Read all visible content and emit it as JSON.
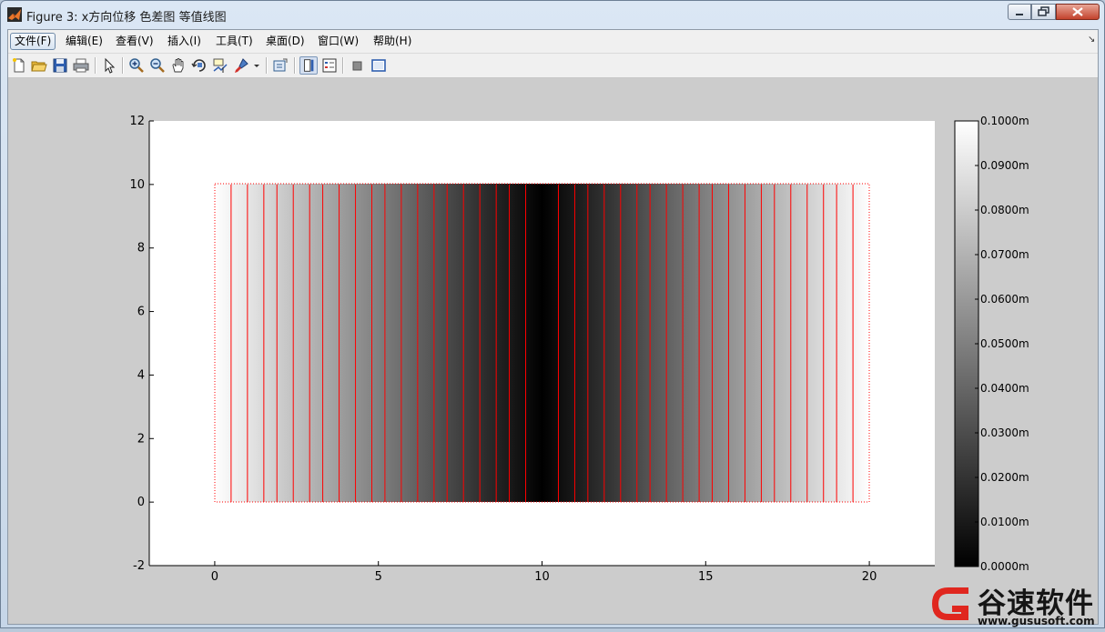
{
  "window": {
    "title": "Figure 3: x方向位移 色差图 等值线图"
  },
  "menu": [
    {
      "label": "文件(F)",
      "name": "menu-file",
      "active": true
    },
    {
      "label": "编辑(E)",
      "name": "menu-edit"
    },
    {
      "label": "查看(V)",
      "name": "menu-view"
    },
    {
      "label": "插入(I)",
      "name": "menu-insert"
    },
    {
      "label": "工具(T)",
      "name": "menu-tools"
    },
    {
      "label": "桌面(D)",
      "name": "menu-desktop"
    },
    {
      "label": "窗口(W)",
      "name": "menu-window"
    },
    {
      "label": "帮助(H)",
      "name": "menu-help"
    }
  ],
  "toolbar": [
    {
      "icon": "new-figure-icon"
    },
    {
      "icon": "open-file-icon"
    },
    {
      "icon": "save-icon"
    },
    {
      "icon": "print-icon"
    },
    {
      "icon": "edit-plot-arrow-icon"
    },
    {
      "icon": "zoom-in-icon"
    },
    {
      "icon": "zoom-out-icon"
    },
    {
      "icon": "pan-hand-icon"
    },
    {
      "icon": "rotate-3d-icon"
    },
    {
      "icon": "data-cursor-icon"
    },
    {
      "icon": "brush-icon"
    },
    {
      "icon": "brush-dropdown-icon"
    },
    {
      "icon": "link-plot-icon"
    },
    {
      "icon": "insert-colorbar-icon"
    },
    {
      "icon": "insert-legend-icon"
    },
    {
      "icon": "hide-plot-tools-icon"
    },
    {
      "icon": "show-plot-tools-icon"
    }
  ],
  "chart_data": {
    "type": "heatmap",
    "title": "",
    "xlabel": "",
    "ylabel": "",
    "xlim": [
      -2,
      22
    ],
    "ylim": [
      -2,
      12
    ],
    "x_ticks": [
      "0",
      "5",
      "10",
      "15",
      "20"
    ],
    "y_ticks": [
      "-2",
      "0",
      "2",
      "4",
      "6",
      "8",
      "10",
      "12"
    ],
    "domain": {
      "x": [
        0,
        20
      ],
      "y": [
        0,
        10
      ]
    },
    "field": "x-displacement, varies with x only: 0 at x=10, rising to 0.1 at x=0 and x=20",
    "colormap": "gray",
    "clim": [
      0,
      0.1
    ],
    "contour_color": "#ff0000",
    "contour_lines_x": [
      0.5,
      1.0,
      1.5,
      1.9,
      2.4,
      2.9,
      3.3,
      3.8,
      4.3,
      4.8,
      5.2,
      5.7,
      6.2,
      6.7,
      7.1,
      7.6,
      8.1,
      8.6,
      9.0,
      9.5,
      10.5,
      11.0,
      11.4,
      11.9,
      12.4,
      12.9,
      13.3,
      13.8,
      14.3,
      14.8,
      15.2,
      15.7,
      16.2,
      16.7,
      17.1,
      17.6,
      18.1,
      18.6,
      19.0,
      19.5
    ],
    "colorbar": {
      "ticks": [
        "0.0000m",
        "0.0100m",
        "0.0200m",
        "0.0300m",
        "0.0400m",
        "0.0500m",
        "0.0600m",
        "0.0700m",
        "0.0800m",
        "0.0900m",
        "0.1000m"
      ],
      "min": 0,
      "max": 0.1
    },
    "grid": false,
    "legend": "none"
  },
  "watermark": {
    "text": "谷速软件",
    "url": "www.gususoft.com",
    "color": "#e0271f"
  }
}
